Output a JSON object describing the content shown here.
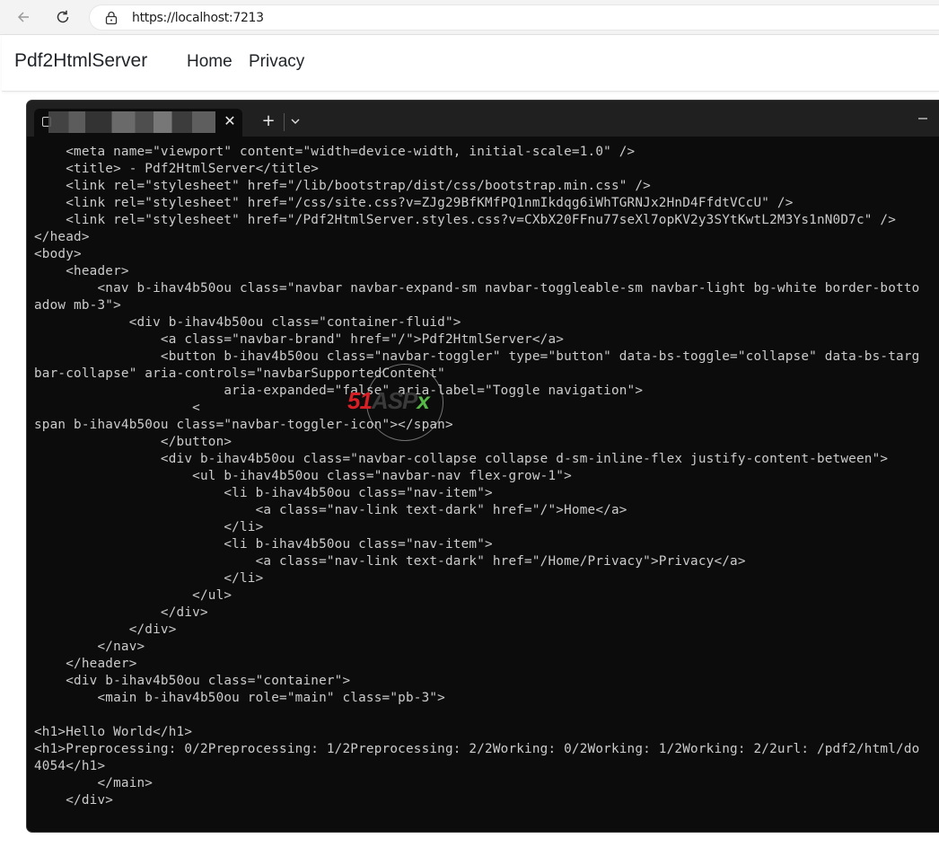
{
  "browser": {
    "url": "https://localhost:7213",
    "back_icon": "arrow-left-icon",
    "reload_icon": "reload-icon",
    "lock_icon": "lock-icon"
  },
  "site": {
    "brand": "Pdf2HtmlServer",
    "nav": [
      "Home",
      "Privacy"
    ]
  },
  "terminal": {
    "tab_close": "✕",
    "new_tab": "+",
    "colors": {
      "background": "#0c0c0c",
      "text": "#cccccc",
      "titlebar": "#202020"
    },
    "lines": [
      "    <meta name=\"viewport\" content=\"width=device-width, initial-scale=1.0\" />",
      "    <title> - Pdf2HtmlServer</title>",
      "    <link rel=\"stylesheet\" href=\"/lib/bootstrap/dist/css/bootstrap.min.css\" />",
      "    <link rel=\"stylesheet\" href=\"/css/site.css?v=ZJg29BfKMfPQ1nmIkdqg6iWhTGRNJx2HnD4FfdtVCcU\" />",
      "    <link rel=\"stylesheet\" href=\"/Pdf2HtmlServer.styles.css?v=CXbX20FFnu77seXl7opKV2y3SYtKwtL2M3Ys1nN0D7c\" />",
      "</head>",
      "<body>",
      "    <header>",
      "        <nav b-ihav4b50ou class=\"navbar navbar-expand-sm navbar-toggleable-sm navbar-light bg-white border-botto",
      "adow mb-3\">",
      "            <div b-ihav4b50ou class=\"container-fluid\">",
      "                <a class=\"navbar-brand\" href=\"/\">Pdf2HtmlServer</a>",
      "                <button b-ihav4b50ou class=\"navbar-toggler\" type=\"button\" data-bs-toggle=\"collapse\" data-bs-targ",
      "bar-collapse\" aria-controls=\"navbarSupportedContent\"",
      "                        aria-expanded=\"false\" aria-label=\"Toggle navigation\">",
      "                    <",
      "span b-ihav4b50ou class=\"navbar-toggler-icon\"></span>",
      "                </button>",
      "                <div b-ihav4b50ou class=\"navbar-collapse collapse d-sm-inline-flex justify-content-between\">",
      "                    <ul b-ihav4b50ou class=\"navbar-nav flex-grow-1\">",
      "                        <li b-ihav4b50ou class=\"nav-item\">",
      "                            <a class=\"nav-link text-dark\" href=\"/\">Home</a>",
      "                        </li>",
      "                        <li b-ihav4b50ou class=\"nav-item\">",
      "                            <a class=\"nav-link text-dark\" href=\"/Home/Privacy\">Privacy</a>",
      "                        </li>",
      "                    </ul>",
      "                </div>",
      "            </div>",
      "        </nav>",
      "    </header>",
      "    <div b-ihav4b50ou class=\"container\">",
      "        <main b-ihav4b50ou role=\"main\" class=\"pb-3\">",
      "",
      "<h1>Hello World</h1>",
      "<h1>Preprocessing: 0/2Preprocessing: 1/2Preprocessing: 2/2Working: 0/2Working: 1/2Working: 2/2url: /pdf2/html/do",
      "4054</h1>",
      "        </main>",
      "    </div>"
    ]
  },
  "watermark": {
    "part1": "51",
    "part2": "ASP",
    "part3": "x"
  }
}
